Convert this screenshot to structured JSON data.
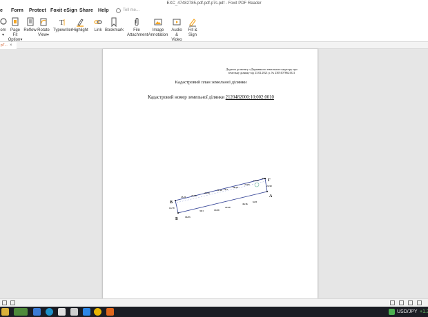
{
  "window": {
    "title": "EXC_47482785.pdf.pdf.p7s.pdf - Foxit PDF Reader"
  },
  "menu": {
    "items": [
      "e",
      "Form",
      "Protect",
      "Foxit eSign",
      "Share",
      "Help"
    ],
    "tellme_placeholder": "Tell me..."
  },
  "ribbon": {
    "zoom": [
      "om",
      "▾"
    ],
    "page_fit": [
      "Page Fit",
      "Option▾"
    ],
    "reflow": [
      "Reflow"
    ],
    "rotate": [
      "Rotate",
      "View▾"
    ],
    "typewriter": [
      "Typewriter"
    ],
    "highlight": [
      "Highlight"
    ],
    "link": [
      "Link"
    ],
    "bookmark": [
      "Bookmark"
    ],
    "file_attachment": [
      "File",
      "Attachment"
    ],
    "image_annotation": [
      "Image",
      "Annotation"
    ],
    "audio_video": [
      "Audio",
      "& Video"
    ],
    "fill_sign": [
      "Fill &",
      "Sign"
    ]
  },
  "doc_tab": {
    "label": "p7...",
    "close": "×"
  },
  "document": {
    "annex_lines": [
      "Додаток до витягу з Державного земельного кадастру про",
      "земельну ділянку від 23.02.2021 р. № 23051078621021"
    ],
    "plan_title": "Кадастровий план земельної ділянки",
    "cadastral_label": "Кадастровий номер земельної ділянки ",
    "cadastral_number": "2120482000:10:002:0010",
    "plot_labels": {
      "corners": [
        "В",
        "Б",
        "А",
        "Г"
      ],
      "top_edge": [
        "15.21",
        "23.95",
        "23.24",
        "11.44",
        "15.2",
        "20.29",
        "27.03",
        "19.93",
        "4.98"
      ],
      "bottom_edge": [
        "16.93",
        "30.1",
        "19.99",
        "22.49",
        "46.16",
        "6.83"
      ],
      "left_edge": "14.79",
      "right_edge": "21.59"
    }
  },
  "taskbar": {
    "ticker": "USD/JPY",
    "ticker_change": "+1.3"
  },
  "colors": {
    "accent": "#d0501a",
    "ribbon_icon": "#f5a623",
    "taskbar": "#1b1d24"
  }
}
